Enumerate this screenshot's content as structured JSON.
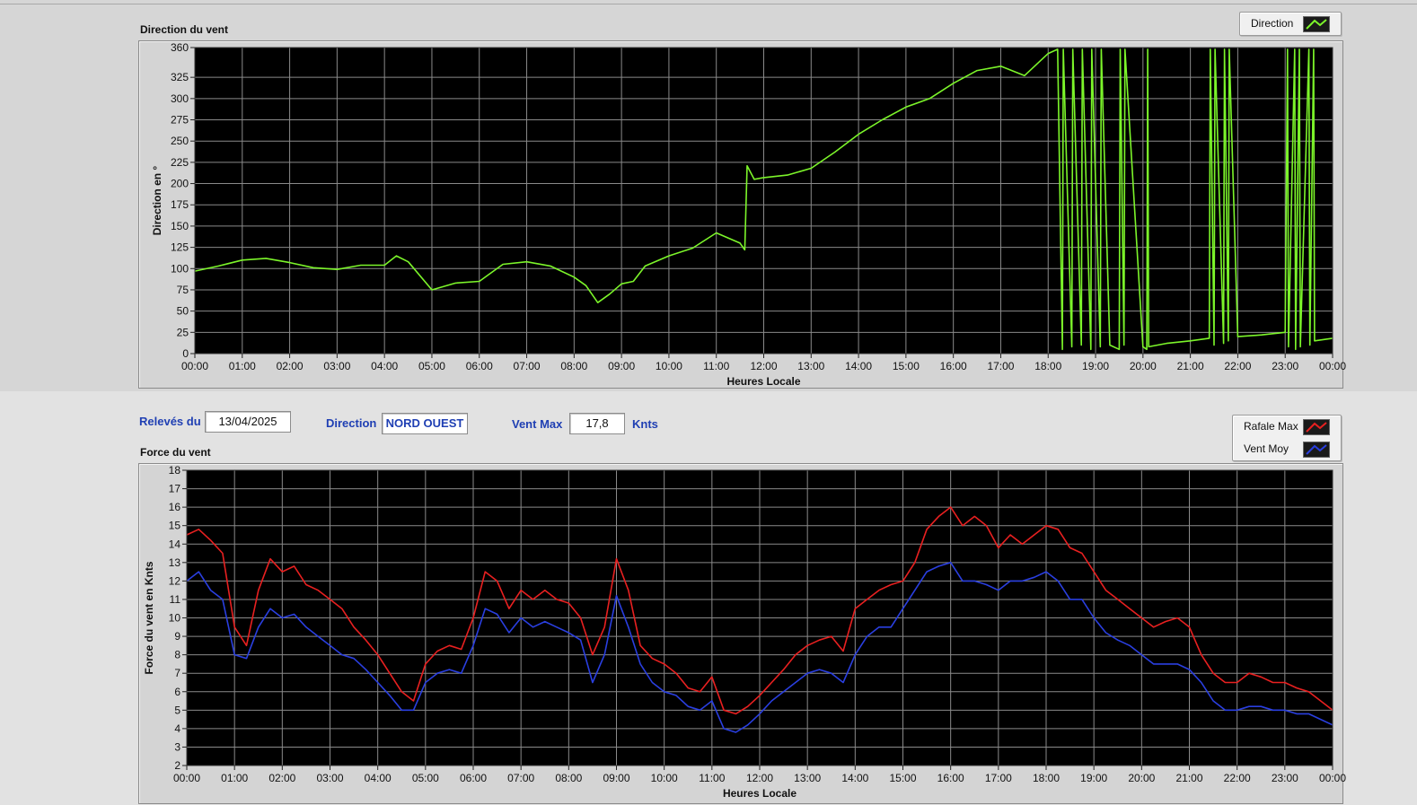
{
  "info": {
    "date_label": "Relevés du",
    "date_value": "13/04/2025",
    "direction_label": "Direction",
    "direction_value": "NORD OUEST",
    "wind_max_label": "Vent Max",
    "wind_max_value": "17,8",
    "wind_max_unit": "Knts"
  },
  "legend_top": {
    "items": [
      {
        "label": "Direction",
        "color": "#7cf52a",
        "icon": "line-swatch-icon"
      }
    ]
  },
  "legend_bottom": {
    "items": [
      {
        "label": "Rafale Max",
        "color": "#e82020",
        "icon": "line-swatch-icon"
      },
      {
        "label": "Vent Moy",
        "color": "#2a3fe0",
        "icon": "line-swatch-icon"
      }
    ]
  },
  "colors": {
    "plot_background": "#000000",
    "grid": "#8a8a8a",
    "direction": "#7cf52a",
    "rafale": "#e82020",
    "moy": "#2a3fe0"
  },
  "chart_data": [
    {
      "type": "line",
      "title": "Direction du vent",
      "xlabel": "Heures Locale",
      "ylabel": "Direction en °",
      "ylim": [
        0,
        360
      ],
      "yticks": [
        0,
        25,
        50,
        75,
        100,
        125,
        150,
        175,
        200,
        225,
        250,
        275,
        300,
        325,
        360
      ],
      "xlim": [
        0,
        24
      ],
      "xticks": [
        "00:00",
        "01:00",
        "02:00",
        "03:00",
        "04:00",
        "05:00",
        "06:00",
        "07:00",
        "08:00",
        "09:00",
        "10:00",
        "11:00",
        "12:00",
        "13:00",
        "14:00",
        "15:00",
        "16:00",
        "17:00",
        "18:00",
        "19:00",
        "20:00",
        "21:00",
        "22:00",
        "23:00",
        "00:00"
      ],
      "grid": true,
      "legend_position": "top-right",
      "series": [
        {
          "name": "Direction",
          "x": [
            0,
            0.5,
            1,
            1.5,
            2,
            2.5,
            3,
            3.5,
            4,
            4.25,
            4.5,
            5,
            5.5,
            6,
            6.25,
            6.5,
            7,
            7.5,
            8,
            8.25,
            8.5,
            8.75,
            9,
            9.25,
            9.5,
            10,
            10.5,
            11,
            11.5,
            11.6,
            11.65,
            11.8,
            12,
            12.5,
            13,
            13.5,
            14,
            14.5,
            15,
            15.5,
            16,
            16.5,
            17,
            17.5,
            18,
            18.2,
            18.3,
            18.32,
            18.5,
            18.52,
            18.7,
            18.72,
            18.9,
            18.92,
            19.1,
            19.12,
            19.3,
            19.5,
            19.52,
            19.6,
            19.62,
            20,
            20.08,
            20.1,
            20.12,
            20.5,
            21,
            21.4,
            21.42,
            21.5,
            21.52,
            21.7,
            21.72,
            21.8,
            21.82,
            22,
            22.5,
            23,
            23.05,
            23.07,
            23.2,
            23.22,
            23.3,
            23.32,
            23.5,
            23.52,
            23.6,
            23.62,
            24
          ],
          "values": [
            97,
            103,
            110,
            112,
            107,
            101,
            99,
            104,
            104,
            115,
            108,
            75,
            83,
            85,
            95,
            105,
            108,
            103,
            90,
            80,
            60,
            70,
            82,
            85,
            103,
            115,
            124,
            142,
            130,
            122,
            221,
            205,
            207,
            210,
            218,
            237,
            258,
            275,
            290,
            300,
            318,
            333,
            338,
            327,
            353,
            358,
            5,
            358,
            8,
            358,
            10,
            358,
            5,
            358,
            8,
            358,
            10,
            5,
            358,
            10,
            358,
            8,
            5,
            358,
            8,
            12,
            15,
            18,
            358,
            10,
            358,
            12,
            358,
            15,
            358,
            20,
            22,
            25,
            358,
            8,
            358,
            5,
            358,
            8,
            358,
            10,
            358,
            15,
            18
          ]
        }
      ]
    },
    {
      "type": "line",
      "title": "Force du vent",
      "xlabel": "Heures Locale",
      "ylabel": "Force du vent en Knts",
      "ylim": [
        2,
        18
      ],
      "yticks": [
        2,
        3,
        4,
        5,
        6,
        7,
        8,
        9,
        10,
        11,
        12,
        13,
        14,
        15,
        16,
        17,
        18
      ],
      "xlim": [
        0,
        24
      ],
      "xticks": [
        "00:00",
        "01:00",
        "02:00",
        "03:00",
        "04:00",
        "05:00",
        "06:00",
        "07:00",
        "08:00",
        "09:00",
        "10:00",
        "11:00",
        "12:00",
        "13:00",
        "14:00",
        "15:00",
        "16:00",
        "17:00",
        "18:00",
        "19:00",
        "20:00",
        "21:00",
        "22:00",
        "23:00",
        "00:00"
      ],
      "grid": true,
      "legend_position": "top-right",
      "x": [
        0,
        0.25,
        0.5,
        0.75,
        1,
        1.25,
        1.5,
        1.75,
        2,
        2.25,
        2.5,
        2.75,
        3,
        3.25,
        3.5,
        3.75,
        4,
        4.25,
        4.5,
        4.75,
        5,
        5.25,
        5.5,
        5.75,
        6,
        6.25,
        6.5,
        6.75,
        7,
        7.25,
        7.5,
        7.75,
        8,
        8.25,
        8.5,
        8.75,
        9,
        9.25,
        9.5,
        9.75,
        10,
        10.25,
        10.5,
        10.75,
        11,
        11.25,
        11.5,
        11.75,
        12,
        12.25,
        12.5,
        12.75,
        13,
        13.25,
        13.5,
        13.75,
        14,
        14.25,
        14.5,
        14.75,
        15,
        15.25,
        15.5,
        15.75,
        16,
        16.25,
        16.5,
        16.75,
        17,
        17.25,
        17.5,
        17.75,
        18,
        18.25,
        18.5,
        18.75,
        19,
        19.25,
        19.5,
        19.75,
        20,
        20.25,
        20.5,
        20.75,
        21,
        21.25,
        21.5,
        21.75,
        22,
        22.25,
        22.5,
        22.75,
        23,
        23.25,
        23.5,
        23.75,
        24
      ],
      "series": [
        {
          "name": "Rafale Max",
          "values": [
            14.5,
            14.8,
            14.2,
            13.5,
            9.5,
            8.5,
            11.5,
            13.2,
            12.5,
            12.8,
            11.8,
            11.5,
            11,
            10.5,
            9.5,
            8.8,
            8,
            7,
            6,
            5.5,
            7.5,
            8.2,
            8.5,
            8.3,
            10,
            12.5,
            12,
            10.5,
            11.5,
            11,
            11.5,
            11,
            10.8,
            10,
            8,
            9.5,
            13.2,
            11.5,
            8.5,
            7.8,
            7.5,
            7,
            6.2,
            6,
            6.8,
            5,
            4.8,
            5.2,
            5.8,
            6.5,
            7.2,
            8,
            8.5,
            8.8,
            9,
            8.2,
            10.5,
            11,
            11.5,
            11.8,
            12,
            13,
            14.8,
            15.5,
            16,
            15,
            15.5,
            15,
            13.8,
            14.5,
            14,
            14.5,
            15,
            14.8,
            13.8,
            13.5,
            12.5,
            11.5,
            11,
            10.5,
            10,
            9.5,
            9.8,
            10,
            9.5,
            8,
            7,
            6.5,
            6.5,
            7,
            6.8,
            6.5,
            6.5,
            6.2,
            6,
            5.5,
            5
          ]
        },
        {
          "name": "Vent Moy",
          "values": [
            12,
            12.5,
            11.5,
            11,
            8,
            7.8,
            9.5,
            10.5,
            10,
            10.2,
            9.5,
            9,
            8.5,
            8,
            7.8,
            7.2,
            6.5,
            5.8,
            5,
            5,
            6.5,
            7,
            7.2,
            7,
            8.5,
            10.5,
            10.2,
            9.2,
            10,
            9.5,
            9.8,
            9.5,
            9.2,
            8.8,
            6.5,
            8,
            11.2,
            9.5,
            7.5,
            6.5,
            6,
            5.8,
            5.2,
            5,
            5.5,
            4,
            3.8,
            4.2,
            4.8,
            5.5,
            6,
            6.5,
            7,
            7.2,
            7,
            6.5,
            8,
            9,
            9.5,
            9.5,
            10.5,
            11.5,
            12.5,
            12.8,
            13,
            12,
            12,
            11.8,
            11.5,
            12,
            12,
            12.2,
            12.5,
            12,
            11,
            11,
            10,
            9.2,
            8.8,
            8.5,
            8,
            7.5,
            7.5,
            7.5,
            7.2,
            6.5,
            5.5,
            5,
            5,
            5.2,
            5.2,
            5,
            5,
            4.8,
            4.8,
            4.5,
            4.2
          ]
        }
      ]
    }
  ]
}
